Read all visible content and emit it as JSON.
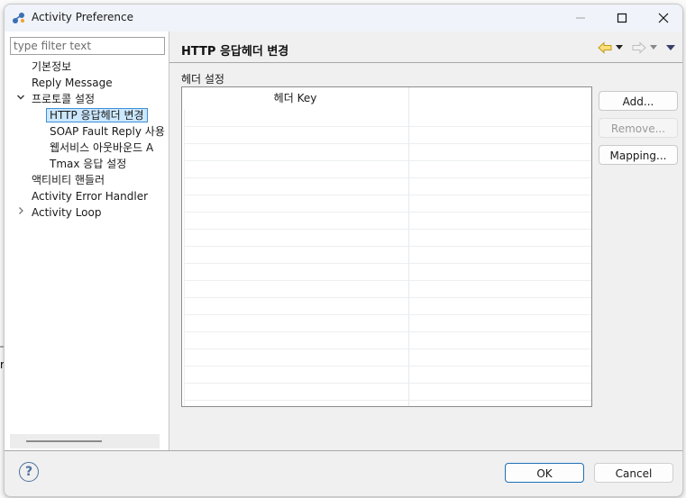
{
  "window": {
    "title": "Activity Preference",
    "controls": {
      "minimize": "—",
      "maximize": "☐",
      "close": "✕"
    }
  },
  "filter": {
    "placeholder": "type filter text",
    "value": ""
  },
  "tree": {
    "items": [
      {
        "label": "기본정보",
        "level": 0,
        "toggle": ""
      },
      {
        "label": "Reply Message",
        "level": 0,
        "toggle": ""
      },
      {
        "label": "프로토콜 설정",
        "level": 0,
        "toggle": "expanded"
      },
      {
        "label": "HTTP 응답헤더 변경",
        "level": 1,
        "toggle": "",
        "selected": true
      },
      {
        "label": "SOAP Fault Reply 사용",
        "level": 1,
        "toggle": ""
      },
      {
        "label": "웹서비스 아웃바운드 A",
        "level": 1,
        "toggle": ""
      },
      {
        "label": "Tmax 응답 설정",
        "level": 1,
        "toggle": ""
      },
      {
        "label": "액티비티 핸들러",
        "level": 0,
        "toggle": ""
      },
      {
        "label": "Activity Error Handler",
        "level": 0,
        "toggle": ""
      },
      {
        "label": "Activity Loop",
        "level": 0,
        "toggle": "collapsed"
      }
    ],
    "icons": {
      "expanded": "chevron-down-icon",
      "collapsed": "chevron-right-icon"
    }
  },
  "page": {
    "title": "HTTP 응답헤더 변경",
    "nav": {
      "back": "back-arrow-icon",
      "back_menu": "dropdown-icon",
      "forward": "forward-arrow-icon",
      "forward_menu": "dropdown-icon",
      "view_menu": "view-menu-icon"
    },
    "section_label": "헤더 설정",
    "table": {
      "columns": [
        "헤더 Key",
        ""
      ],
      "rows": []
    },
    "buttons": {
      "add": "Add...",
      "remove": "Remove...",
      "mapping": "Mapping..."
    }
  },
  "footer": {
    "help_icon": "?",
    "ok": "OK",
    "cancel": "Cancel"
  },
  "background": {
    "partial_text": "r"
  }
}
